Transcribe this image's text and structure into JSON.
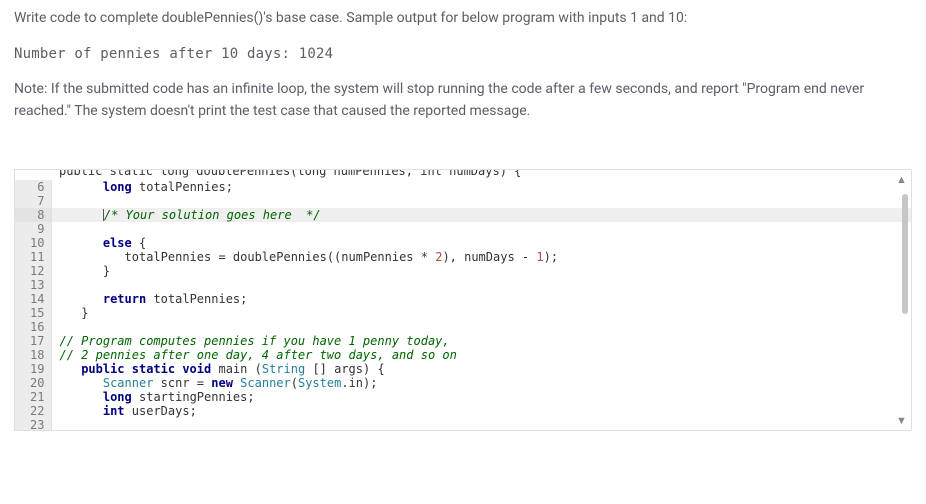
{
  "problem": {
    "prompt_line1": "Write code to complete doublePennies()'s base case. Sample output for below program with inputs 1 and 10:",
    "sample_output": "Number of pennies after 10 days: 1024",
    "note": "Note: If the submitted code has an infinite loop, the system will stop running the code after a few seconds, and report \"Program end never reached.\" The system doesn't print the test case that caused the reported message."
  },
  "editor": {
    "partial_top_hint": "public static long doublePennies(long numPennies, int numDays) {",
    "lines": [
      {
        "num": "6",
        "indent": "      ",
        "tokens": [
          {
            "t": "kw",
            "v": "long"
          },
          {
            "t": "sp",
            "v": " "
          },
          {
            "t": "id",
            "v": "totalPennies;"
          }
        ]
      },
      {
        "num": "7",
        "indent": "",
        "tokens": []
      },
      {
        "num": "8",
        "indent": "      ",
        "highlight": true,
        "cursor": true,
        "tokens": [
          {
            "t": "cmt",
            "v": "/* Your solution goes here  */"
          }
        ]
      },
      {
        "num": "9",
        "indent": "",
        "tokens": []
      },
      {
        "num": "10",
        "indent": "      ",
        "tokens": [
          {
            "t": "kw",
            "v": "else"
          },
          {
            "t": "sp",
            "v": " "
          },
          {
            "t": "id",
            "v": "{"
          }
        ]
      },
      {
        "num": "11",
        "indent": "         ",
        "tokens": [
          {
            "t": "id",
            "v": "totalPennies = doublePennies((numPennies * "
          },
          {
            "t": "num",
            "v": "2"
          },
          {
            "t": "id",
            "v": "), numDays - "
          },
          {
            "t": "num",
            "v": "1"
          },
          {
            "t": "id",
            "v": ");"
          }
        ]
      },
      {
        "num": "12",
        "indent": "      ",
        "tokens": [
          {
            "t": "id",
            "v": "}"
          }
        ]
      },
      {
        "num": "13",
        "indent": "",
        "tokens": []
      },
      {
        "num": "14",
        "indent": "      ",
        "tokens": [
          {
            "t": "kw",
            "v": "return"
          },
          {
            "t": "sp",
            "v": " "
          },
          {
            "t": "id",
            "v": "totalPennies;"
          }
        ]
      },
      {
        "num": "15",
        "indent": "   ",
        "tokens": [
          {
            "t": "id",
            "v": "}"
          }
        ]
      },
      {
        "num": "16",
        "indent": "",
        "tokens": []
      },
      {
        "num": "17",
        "indent": "",
        "tokens": [
          {
            "t": "cmt",
            "v": "// Program computes pennies if you have 1 penny today,"
          }
        ]
      },
      {
        "num": "18",
        "indent": "",
        "tokens": [
          {
            "t": "cmt",
            "v": "// 2 pennies after one day, 4 after two days, and so on"
          }
        ]
      },
      {
        "num": "19",
        "indent": "   ",
        "tokens": [
          {
            "t": "kw",
            "v": "public static void"
          },
          {
            "t": "sp",
            "v": " "
          },
          {
            "t": "fn",
            "v": "main"
          },
          {
            "t": "sp",
            "v": " "
          },
          {
            "t": "id",
            "v": "("
          },
          {
            "t": "cls",
            "v": "String"
          },
          {
            "t": "sp",
            "v": " "
          },
          {
            "t": "id",
            "v": "[] args) {"
          }
        ]
      },
      {
        "num": "20",
        "indent": "      ",
        "tokens": [
          {
            "t": "cls",
            "v": "Scanner"
          },
          {
            "t": "sp",
            "v": " "
          },
          {
            "t": "id",
            "v": "scnr = "
          },
          {
            "t": "kw",
            "v": "new"
          },
          {
            "t": "sp",
            "v": " "
          },
          {
            "t": "cls",
            "v": "Scanner"
          },
          {
            "t": "id",
            "v": "("
          },
          {
            "t": "cls",
            "v": "System"
          },
          {
            "t": "id",
            "v": ".in);"
          }
        ]
      },
      {
        "num": "21",
        "indent": "      ",
        "tokens": [
          {
            "t": "kw",
            "v": "long"
          },
          {
            "t": "sp",
            "v": " "
          },
          {
            "t": "id",
            "v": "startingPennies;"
          }
        ]
      },
      {
        "num": "22",
        "indent": "      ",
        "tokens": [
          {
            "t": "kw",
            "v": "int"
          },
          {
            "t": "sp",
            "v": " "
          },
          {
            "t": "id",
            "v": "userDays;"
          }
        ]
      },
      {
        "num": "23",
        "indent": "",
        "tokens": []
      }
    ],
    "scroll": {
      "up_glyph": "▲",
      "down_glyph": "▼"
    }
  }
}
